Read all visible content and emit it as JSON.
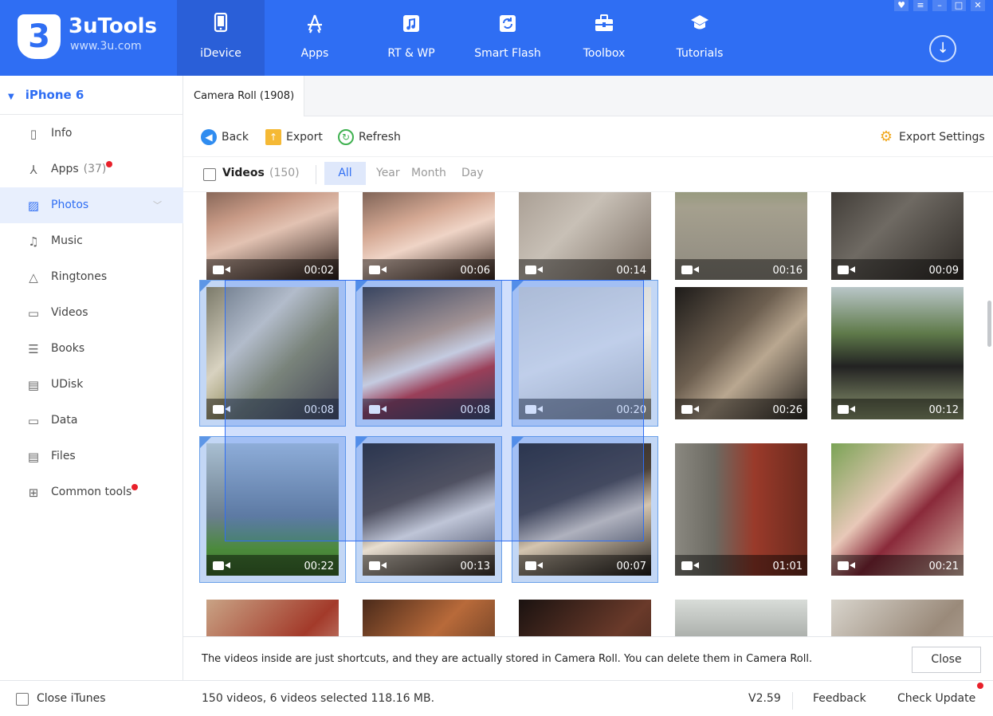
{
  "app": {
    "name": "3uTools",
    "url": "www.3u.com",
    "brand_color": "#2f6ef3"
  },
  "nav": [
    {
      "label": "iDevice",
      "icon": "phone-icon"
    },
    {
      "label": "Apps",
      "icon": "app-store-icon"
    },
    {
      "label": "RT & WP",
      "icon": "music-note-icon"
    },
    {
      "label": "Smart Flash",
      "icon": "refresh-icon"
    },
    {
      "label": "Toolbox",
      "icon": "toolbox-icon"
    },
    {
      "label": "Tutorials",
      "icon": "graduation-cap-icon"
    }
  ],
  "sidebar": {
    "device": "iPhone 6",
    "items": [
      {
        "label": "Info",
        "icon": "info-icon"
      },
      {
        "label": "Apps",
        "count": "(37)",
        "icon": "apps-icon"
      },
      {
        "label": "Photos",
        "icon": "photos-icon"
      },
      {
        "label": "Music",
        "icon": "music-icon"
      },
      {
        "label": "Ringtones",
        "icon": "bell-icon"
      },
      {
        "label": "Videos",
        "icon": "video-icon"
      },
      {
        "label": "Books",
        "icon": "books-icon"
      },
      {
        "label": "UDisk",
        "icon": "udisk-icon"
      },
      {
        "label": "Data",
        "icon": "folder-icon"
      },
      {
        "label": "Files",
        "icon": "file-icon"
      },
      {
        "label": "Common tools",
        "icon": "grid-icon"
      }
    ],
    "close_itunes": "Close iTunes"
  },
  "tab": "Camera Roll (1908)",
  "toolbar": {
    "back": "Back",
    "export": "Export",
    "refresh": "Refresh",
    "export_settings": "Export Settings"
  },
  "filter": {
    "videos_label": "Videos",
    "videos_count": "(150)",
    "all": "All",
    "year": "Year",
    "month": "Month",
    "day": "Day"
  },
  "thumbnails": [
    {
      "duration": "00:02",
      "selected": false
    },
    {
      "duration": "00:06",
      "selected": false
    },
    {
      "duration": "00:14",
      "selected": false
    },
    {
      "duration": "00:16",
      "selected": false
    },
    {
      "duration": "00:09",
      "selected": false
    },
    {
      "duration": "00:08",
      "selected": true
    },
    {
      "duration": "00:08",
      "selected": true
    },
    {
      "duration": "00:20",
      "selected": true
    },
    {
      "duration": "00:26",
      "selected": false
    },
    {
      "duration": "00:12",
      "selected": false
    },
    {
      "duration": "00:22",
      "selected": true
    },
    {
      "duration": "00:13",
      "selected": true
    },
    {
      "duration": "00:07",
      "selected": true
    },
    {
      "duration": "01:01",
      "selected": false
    },
    {
      "duration": "00:21",
      "selected": false
    },
    {
      "duration": "",
      "selected": false
    },
    {
      "duration": "",
      "selected": false
    },
    {
      "duration": "",
      "selected": false
    },
    {
      "duration": "",
      "selected": false
    },
    {
      "duration": "",
      "selected": false
    }
  ],
  "notice": {
    "text": "The videos inside are just shortcuts, and they are actually stored in Camera Roll. You can delete them in Camera Roll.",
    "close": "Close"
  },
  "status": {
    "summary": "150 videos, 6 videos selected 118.16 MB.",
    "version": "V2.59",
    "feedback": "Feedback",
    "check_update": "Check Update"
  }
}
